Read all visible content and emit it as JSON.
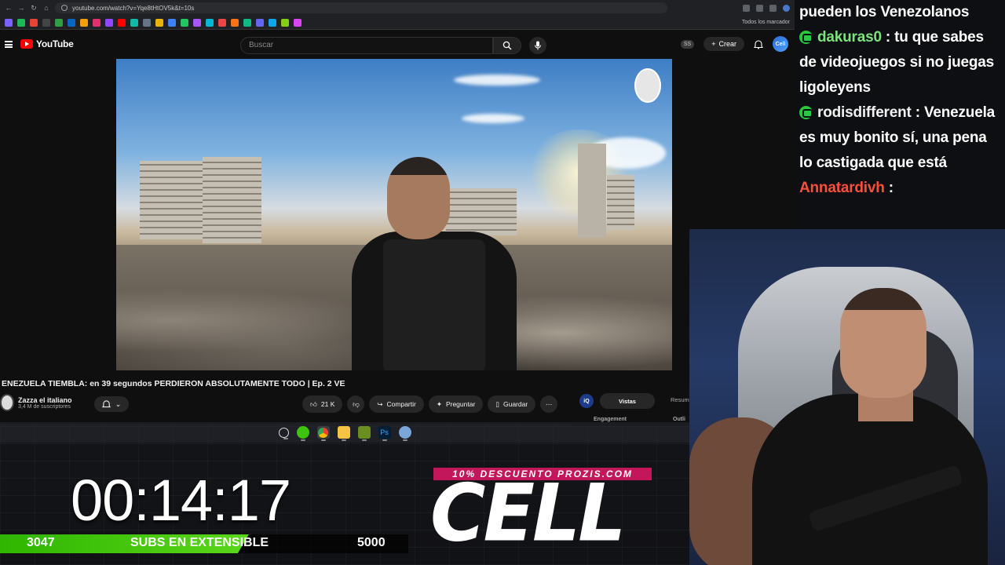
{
  "browser": {
    "url": "youtube.com/watch?v=Yqe8tHtOV5k&t=10s",
    "bookmarks_all_label": "Todos los marcador"
  },
  "youtube": {
    "logo_text": "YouTube",
    "search_placeholder": "Buscar",
    "ss_badge": "SS",
    "create_label": "Crear",
    "avatar_initials": "Cell"
  },
  "video": {
    "title": "ENEZUELA TIEMBLA: en 39 segundos PERDIERON ABSOLUTAMENTE TODO | Ep. 2 VE",
    "channel_name": "Zazza el italiano",
    "subscribers": "3,4 M de suscriptores",
    "likes": "21 K",
    "share_label": "Compartir",
    "ask_label": "Preguntar",
    "save_label": "Guardar"
  },
  "side_panel": {
    "iq": "iQ",
    "tab_active": "Vistas",
    "tab_other": "Resum",
    "engagement": "Engagement",
    "outline": "Outli"
  },
  "overlay": {
    "timer": "00:14:17",
    "subs_current": "3047",
    "subs_label": "SUBS EN EXTENSIBLE",
    "subs_goal": "5000",
    "subs_progress": 0.6094,
    "promo": "10% DESCUENTO PROZIS.COM",
    "brand": "CELL"
  },
  "chat": [
    {
      "user": "",
      "text": "pueden los Venezolanos",
      "badge": false,
      "user_color": "plain"
    },
    {
      "user": "dakuras0",
      "text": ": tu que sabes de videojuegos si no juegas ligoleyens",
      "badge": true,
      "user_color": "green"
    },
    {
      "user": "rodisdifferent",
      "text": ": Venezuela es muy bonito sí, una pena lo castigada que está",
      "badge": true,
      "user_color": "plain"
    },
    {
      "user": "Annatardivh",
      "text": ":",
      "badge": false,
      "user_color": "red"
    }
  ],
  "colors": {
    "yt_red": "#ff0000",
    "chat_green": "#7be37b",
    "chat_red": "#ff4f3a",
    "subs_green": "#3ec40c",
    "promo_pink": "#c2185b"
  }
}
